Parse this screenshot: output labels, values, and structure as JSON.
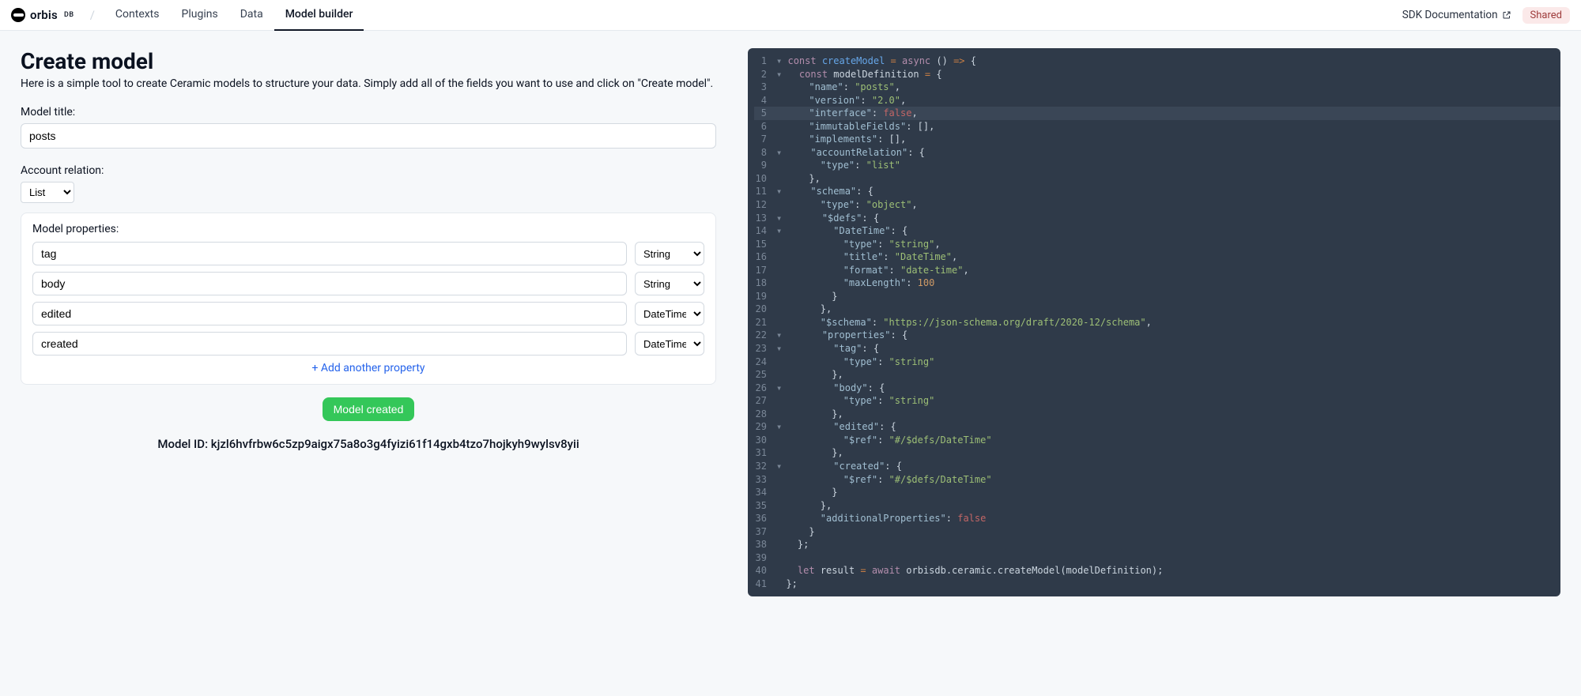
{
  "header": {
    "logo_text": "orbis",
    "logo_sub": "DB",
    "nav": [
      {
        "label": "Contexts",
        "active": false
      },
      {
        "label": "Plugins",
        "active": false
      },
      {
        "label": "Data",
        "active": false
      },
      {
        "label": "Model builder",
        "active": true
      }
    ],
    "doc_link": "SDK Documentation",
    "badge": "Shared"
  },
  "page": {
    "title": "Create model",
    "subtitle": "Here is a simple tool to create Ceramic models to structure your data. Simply add all of the fields you want to use and click on \"Create model\".",
    "model_title_label": "Model title:",
    "model_title_value": "posts",
    "relation_label": "Account relation:",
    "relation_selected": "List",
    "relation_options": [
      "List"
    ],
    "props_label": "Model properties:",
    "type_options": [
      "String",
      "DateTime"
    ],
    "properties": [
      {
        "name": "tag",
        "type": "String"
      },
      {
        "name": "body",
        "type": "String"
      },
      {
        "name": "edited",
        "type": "DateTime"
      },
      {
        "name": "created",
        "type": "DateTime"
      }
    ],
    "add_text": "+ Add another property",
    "button_label": "Model created",
    "modelid_prefix": "Model ID: ",
    "modelid_value": "kjzl6hvfrbw6c5zp9aigx75a8o3g4fyizi61f14gxb4tzo7hojkyh9wylsv8yii"
  },
  "code_model_name": "posts",
  "code_version": "2.0",
  "code_list": "list",
  "code_datetime_fmt": "date-time",
  "code_maxlen": 100
}
